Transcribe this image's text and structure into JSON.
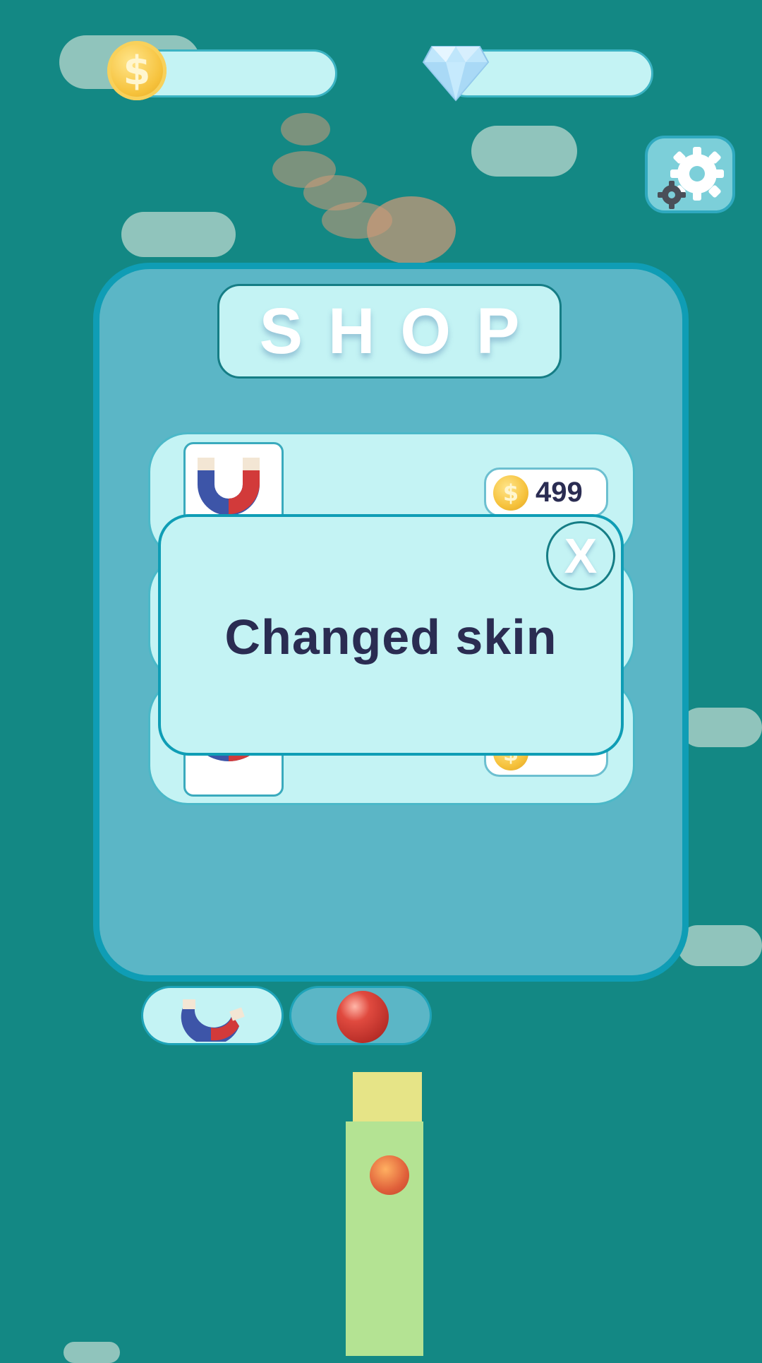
{
  "header": {
    "coins_value": "",
    "gems_value": "",
    "coin_symbol": "$"
  },
  "shop": {
    "title": "SHOP",
    "items": [
      {
        "price": "499",
        "coin_symbol": "$"
      },
      {
        "price": "",
        "coin_symbol": "$"
      },
      {
        "price": "",
        "coin_symbol": "$"
      }
    ]
  },
  "popup": {
    "message": "Changed skin",
    "close_label": "X"
  },
  "tabs": [
    {
      "icon": "magnet-icon",
      "active": true
    },
    {
      "icon": "ball-icon",
      "active": false
    }
  ],
  "colors": {
    "background": "#138884",
    "panel": "#5bb6c6",
    "panel_border": "#0f9db5",
    "light_fill": "#c4f3f4",
    "text_dark": "#2a2c52"
  }
}
